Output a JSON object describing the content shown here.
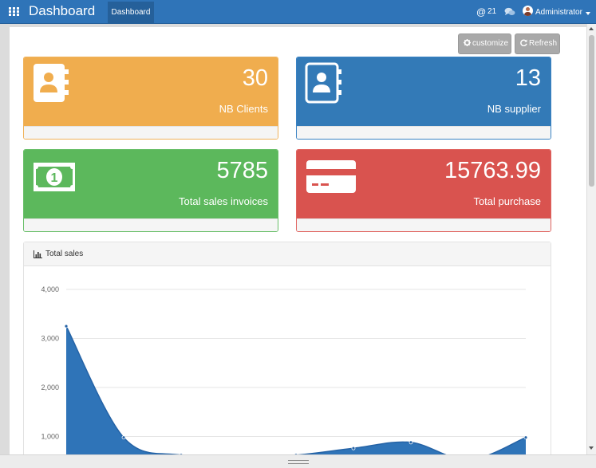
{
  "app": {
    "title": "Dashboard"
  },
  "nav": {
    "active_tab": "Dashboard",
    "mentions_count": "21",
    "user_name": "Administrator",
    "icons": [
      "apps-grid-icon",
      "at-sign-icon",
      "chat-bubbles-icon",
      "user-avatar-icon",
      "caret-down-icon"
    ]
  },
  "toolbar": {
    "customize_label": "customize",
    "refresh_label": "Refresh"
  },
  "cards": [
    {
      "value": "30",
      "label": "NB Clients",
      "icon": "address-book-icon",
      "color": "#f0ad4e"
    },
    {
      "value": "13",
      "label": "NB supplier",
      "icon": "address-book-icon",
      "color": "#337ab7"
    },
    {
      "value": "5785",
      "label": "Total sales invoices",
      "icon": "money-bill-icon",
      "color": "#5cb85c"
    },
    {
      "value": "15763.99",
      "label": "Total purchase",
      "icon": "credit-card-icon",
      "color": "#d9534f"
    }
  ],
  "chart_panel": {
    "title": "Total sales"
  },
  "chart_data": {
    "type": "area",
    "title": "Total sales",
    "xlabel": "",
    "ylabel": "",
    "ylim": [
      0,
      4000
    ],
    "y_ticks": [
      "4,000",
      "3,000",
      "2,000",
      "1,000"
    ],
    "y_tick_values": [
      4000,
      3000,
      2000,
      1000
    ],
    "grid": true,
    "color": "#2f74b8",
    "series": [
      {
        "x": [
          0,
          1,
          2,
          3,
          4,
          5,
          6,
          7,
          8
        ],
        "values": [
          3250,
          980,
          620,
          560,
          620,
          760,
          880,
          520,
          980
        ]
      }
    ]
  }
}
